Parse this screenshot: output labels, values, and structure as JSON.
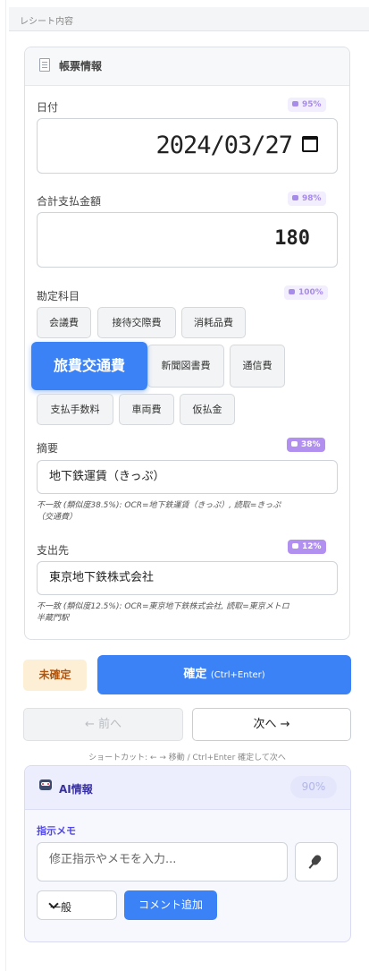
{
  "header": {
    "title": "レシート内容"
  },
  "form_card": {
    "title": "帳票情報",
    "icon": "document-icon",
    "date": {
      "label": "日付",
      "confidence": "95%",
      "value": "2024/03/27"
    },
    "amount": {
      "label": "合計支払金額",
      "confidence": "98%",
      "value": "180"
    },
    "account": {
      "label": "勘定科目",
      "confidence": "100%",
      "selected": "旅費交通費",
      "options": [
        "会議費",
        "接待交際費",
        "消耗品費",
        "旅費交通費",
        "新聞図書費",
        "通信費",
        "支払手数料",
        "車両費",
        "仮払金"
      ]
    },
    "summary": {
      "label": "摘要",
      "confidence": "38%",
      "value": "地下鉄運賃（きっぷ）",
      "note_line1": "不一致 (類似度38.5%): OCR=地下鉄運賃（きっぷ）, 読取=きっぷ",
      "note_line2": "（交通費）"
    },
    "payee": {
      "label": "支出先",
      "confidence": "12%",
      "value": "東京地下鉄株式会社",
      "note_line1": "不一致 (類似度12.5%): OCR=東京地下鉄株式会社, 読取=東京メトロ",
      "note_line2": "半蔵門駅"
    }
  },
  "actions": {
    "status": "未確定",
    "confirm_label": "確定",
    "confirm_shortcut": "(Ctrl+Enter)",
    "prev_label": "← 前へ",
    "next_label": "次へ →",
    "shortcut_hint": "ショートカット: ← → 移動 / Ctrl+Enter 確定して次へ"
  },
  "ai_panel": {
    "title": "AI情報",
    "confidence": "90%",
    "memo_label": "指示メモ",
    "memo_placeholder": "修正指示やメモを入力...",
    "category_value": "一般",
    "add_comment_label": "コメント追加"
  },
  "colors": {
    "accent": "#3b82f6",
    "badge_light": "#f3eefe",
    "badge_dark": "#b290f0",
    "pending_bg": "#fdefd6",
    "pending_text": "#b45309"
  }
}
